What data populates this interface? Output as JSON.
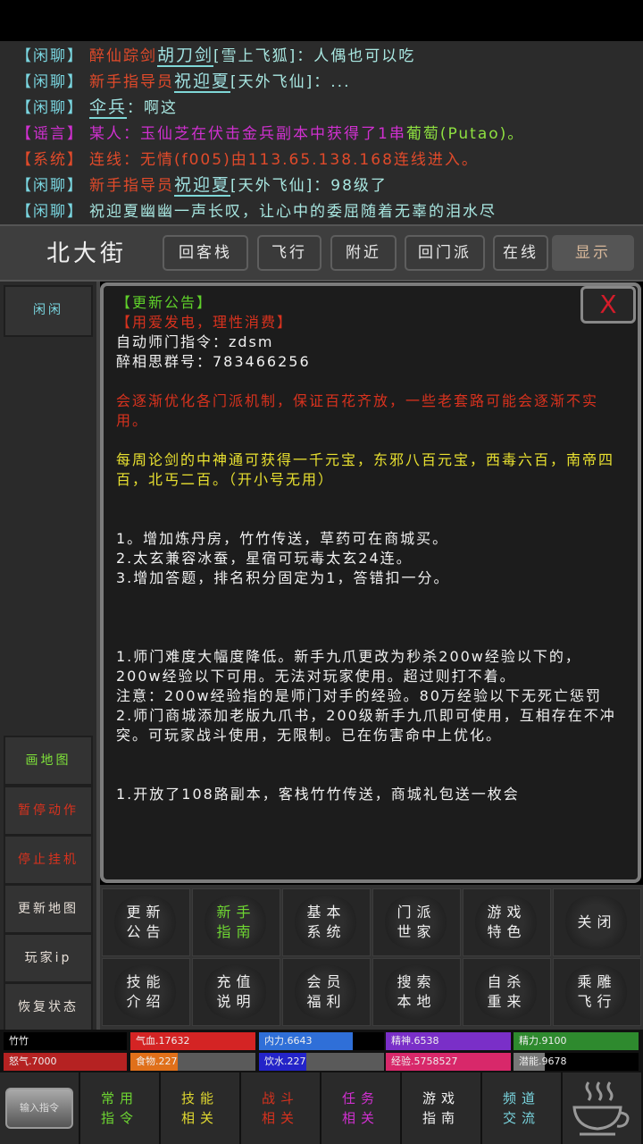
{
  "chat": [
    {
      "channel": "【闲聊】",
      "channel_color": "#7ad6e0",
      "prefix": "醉仙踪剑",
      "prefix_color": "#e04a2a",
      "name": "胡刀剑",
      "name_color": "#9fe0e0",
      "rest": "[雪上飞狐]：人偶也可以吃",
      "rest_color": "#a8e6e0"
    },
    {
      "channel": "【闲聊】",
      "channel_color": "#7ad6e0",
      "prefix": "新手指导员",
      "prefix_color": "#e04a2a",
      "name": "祝迎夏",
      "name_color": "#9fe0e0",
      "rest": "[天外飞仙]：...",
      "rest_color": "#a8e6e0"
    },
    {
      "channel": "【闲聊】",
      "channel_color": "#7ad6e0",
      "prefix": "",
      "prefix_color": "#e04a2a",
      "name": "伞兵",
      "name_color": "#9fe0e0",
      "rest": "：啊这",
      "rest_color": "#a8e6e0"
    },
    {
      "channel": "【谣言】",
      "channel_color": "#d030d0",
      "prefix": "某人：玉仙芝在伏击金兵副本中获得了1串",
      "prefix_color": "#d030d0",
      "name": "",
      "name_color": "#9fe0e0",
      "rest": "葡萄(Putao)。",
      "rest_color": "#8ee040"
    },
    {
      "channel": "【系统】",
      "channel_color": "#e04a2a",
      "prefix": "连线：无情(f005)由113.65.138.168连线进入。",
      "prefix_color": "#e04a2a",
      "name": "",
      "name_color": "#9fe0e0",
      "rest": "",
      "rest_color": "#a8e6e0"
    },
    {
      "channel": "【闲聊】",
      "channel_color": "#7ad6e0",
      "prefix": "新手指导员",
      "prefix_color": "#e04a2a",
      "name": "祝迎夏",
      "name_color": "#9fe0e0",
      "rest": "[天外飞仙]：98级了",
      "rest_color": "#a8e6e0"
    },
    {
      "channel": "【闲聊】",
      "channel_color": "#7ad6e0",
      "prefix": "",
      "prefix_color": "#e04a2a",
      "name": "",
      "name_color": "#9fe0e0",
      "rest": "祝迎夏幽幽一声长叹，让心中的委屈随着无辜的泪水尽",
      "rest_color": "#a8e6e0"
    }
  ],
  "location": {
    "name": "北大街",
    "buttons": [
      "回客栈",
      "飞行",
      "附近",
      "回门派",
      "在线",
      "显示"
    ]
  },
  "sidebar": {
    "top": "闲闲",
    "items": [
      {
        "label": "画地图",
        "color": "#7ee03a"
      },
      {
        "label": "暂停动作",
        "color": "#d8321e"
      },
      {
        "label": "停止挂机",
        "color": "#d8321e"
      },
      {
        "label": "更新地图",
        "color": "#e8e0d8"
      },
      {
        "label": "玩家ip",
        "color": "#e8e0d8"
      },
      {
        "label": "恢复状态",
        "color": "#e8e0d8"
      }
    ]
  },
  "notice": {
    "close_label": "X",
    "lines": [
      {
        "text": "【更新公告】",
        "color": "#5fd02a"
      },
      {
        "text": "【用爱发电，理性消费】",
        "color": "#d8321e"
      },
      {
        "text": "自动师门指令：zdsm",
        "color": "#f0f0f0"
      },
      {
        "text": "醉相思群号：783466256",
        "color": "#f0f0f0"
      },
      {
        "text": "",
        "color": ""
      },
      {
        "text": "会逐渐优化各门派机制，保证百花齐放，一些老套路可能会逐渐不实用。",
        "color": "#d8321e"
      },
      {
        "text": "",
        "color": ""
      },
      {
        "text": "每周论剑的中神通可获得一千元宝，东邪八百元宝，西毒六百，南帝四百，北丐二百。（开小号无用）",
        "color": "#e8e030"
      },
      {
        "text": "",
        "color": ""
      },
      {
        "text": "",
        "color": ""
      },
      {
        "text": "1。增加炼丹房，竹竹传送，草药可在商城买。",
        "color": "#f0f0f0"
      },
      {
        "text": "2.太玄兼容冰蚕，星宿可玩毒太玄24连。",
        "color": "#f0f0f0"
      },
      {
        "text": "3.增加答题，排名积分固定为1，答错扣一分。",
        "color": "#f0f0f0"
      },
      {
        "text": "",
        "color": ""
      },
      {
        "text": "",
        "color": ""
      },
      {
        "text": "",
        "color": ""
      },
      {
        "text": "1.师门难度大幅度降低。新手九爪更改为秒杀200w经验以下的，200w经验以下可用。无法对玩家使用。超过则打不着。",
        "color": "#f0f0f0"
      },
      {
        "text": "注意：200w经验指的是师门对手的经验。80万经验以下无死亡惩罚",
        "color": "#f0f0f0"
      },
      {
        "text": "2.师门商城添加老版九爪书，200级新手九爪即可使用，互相存在不冲突。可玩家战斗使用，无限制。已在伤害命中上优化。",
        "color": "#f0f0f0"
      },
      {
        "text": "",
        "color": ""
      },
      {
        "text": "",
        "color": ""
      },
      {
        "text": "1.开放了108路副本，客栈竹竹传送，商城礼包送一枚会",
        "color": "#f0f0f0"
      }
    ]
  },
  "menu": [
    {
      "label": "更新公告",
      "color": "#f0f0f0"
    },
    {
      "label": "新手指南",
      "color": "#6ed632"
    },
    {
      "label": "基本系统",
      "color": "#f0f0f0"
    },
    {
      "label": "门派世家",
      "color": "#f0f0f0"
    },
    {
      "label": "游戏特色",
      "color": "#f0f0f0"
    },
    {
      "label": "关闭",
      "color": "#f0f0f0"
    },
    {
      "label": "技能介绍",
      "color": "#f0f0f0"
    },
    {
      "label": "充值说明",
      "color": "#f0f0f0"
    },
    {
      "label": "会员福利",
      "color": "#f0f0f0"
    },
    {
      "label": "搜索本地",
      "color": "#f0f0f0"
    },
    {
      "label": "自杀重来",
      "color": "#f0f0f0"
    },
    {
      "label": "乘雕飞行",
      "color": "#f0f0f0"
    }
  ],
  "stats": {
    "player_name": "竹竹",
    "items": [
      {
        "label": "气血.17632",
        "fill_color": "#d42424",
        "fill": 1.0
      },
      {
        "label": "内力.6643",
        "fill_color": "#2f6fd8",
        "fill": 0.75
      },
      {
        "label": "精神.6538",
        "fill_color": "#7a2fc8",
        "fill": 1.0
      },
      {
        "label": "精力.9100",
        "fill_color": "#2e8a2e",
        "fill": 1.0
      },
      {
        "label": "怒气.7000",
        "fill_color": "#b52222",
        "fill": 1.0
      },
      {
        "label": "食物.227",
        "fill_color": "#e0701a",
        "fill": 0.38
      },
      {
        "label": "饮水.227",
        "fill_color": "#2424c8",
        "fill": 0.38
      },
      {
        "label": "经验.5758527",
        "fill_color": "#d8286a",
        "fill": 1.0
      },
      {
        "label": "潜能.9678",
        "fill_color": "#777777",
        "fill": 0.25
      }
    ]
  },
  "bottom": {
    "input_label": "输入指令",
    "items": [
      {
        "label": "常用指令",
        "color": "#6ed632"
      },
      {
        "label": "技能相关",
        "color": "#e0d830"
      },
      {
        "label": "战斗相关",
        "color": "#d8321e"
      },
      {
        "label": "任务相关",
        "color": "#d030d0"
      },
      {
        "label": "游戏指南",
        "color": "#f0f0f0"
      },
      {
        "label": "频道交流",
        "color": "#7ad6e0"
      }
    ],
    "cup_icon": "coffee-cup-icon"
  }
}
